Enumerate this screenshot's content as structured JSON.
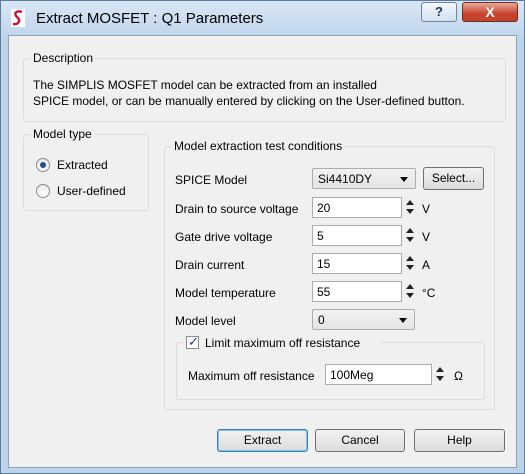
{
  "window": {
    "title": "Extract MOSFET : Q1 Parameters",
    "help_glyph": "?",
    "close_glyph": "X"
  },
  "description": {
    "label": "Description",
    "line1": "The SIMPLIS MOSFET model can be extracted from an installed",
    "line2": "SPICE model, or can be manually entered by clicking on the User-defined button."
  },
  "model_type": {
    "label": "Model type",
    "options": [
      {
        "label": "Extracted",
        "selected": true
      },
      {
        "label": "User-defined",
        "selected": false
      }
    ]
  },
  "conditions": {
    "label": "Model extraction test conditions",
    "spice_model": {
      "label": "SPICE Model",
      "value": "Si4410DY",
      "select_label": "Select..."
    },
    "drain_source_voltage": {
      "label": "Drain to source voltage",
      "value": "20",
      "unit": "V"
    },
    "gate_drive_voltage": {
      "label": "Gate drive voltage",
      "value": "5",
      "unit": "V"
    },
    "drain_current": {
      "label": "Drain current",
      "value": "15",
      "unit": "A"
    },
    "model_temperature": {
      "label": "Model temperature",
      "value": "55",
      "unit": "°C"
    },
    "model_level": {
      "label": "Model level",
      "value": "0"
    },
    "limit_off_resistance": {
      "label": "Limit maximum off resistance",
      "checked": true,
      "max_label": "Maximum off resistance",
      "value": "100Meg",
      "unit": "Ω"
    }
  },
  "buttons": {
    "extract": "Extract",
    "cancel": "Cancel",
    "help": "Help"
  },
  "colors": {
    "frame": "#bcd3ea",
    "dialog_bg": "#f0f0f0",
    "close_button": "#c7432c",
    "radio_selected": "#1d4f8c"
  }
}
